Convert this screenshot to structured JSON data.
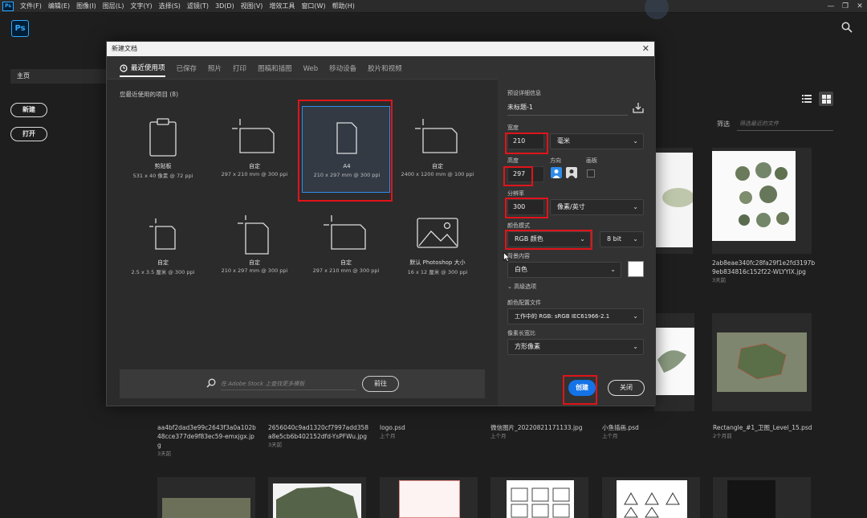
{
  "menubar": {
    "logo": "Ps",
    "items": [
      "文件(F)",
      "编辑(E)",
      "图像(I)",
      "图层(L)",
      "文字(Y)",
      "选择(S)",
      "滤镜(T)",
      "3D(D)",
      "视图(V)",
      "增效工具",
      "窗口(W)",
      "帮助(H)"
    ],
    "window_controls": [
      "—",
      "❐",
      "✕"
    ]
  },
  "home": {
    "logo": "Ps",
    "sidebar_tab": "主页",
    "new_button": "新建",
    "open_button": "打开",
    "filter_label": "筛选",
    "filter_placeholder": "筛选最近的文件"
  },
  "background_files": [
    {
      "name": "2ab8eae340fc28fa29f1e2fd3197b9eb834816c152f22-WLYYIX.jpg",
      "time": "3天前"
    },
    {
      "name": "aa4bf2dad3e99c2643f3a0a102b48cce377de9f83ec59-emxjgx.jpg",
      "time": "3天前"
    },
    {
      "name": "2656040c9ad1320cf7997add358a8e5cb6b402152dfd-YsPFWu.jpg",
      "time": "3天前"
    },
    {
      "name": "logo.psd",
      "time": "上个月"
    },
    {
      "name": "微信图片_20220821171133.jpg",
      "time": "上个月"
    },
    {
      "name": "小鱼插画.psd",
      "time": "上个月"
    },
    {
      "name": "Rectangle_#1_卫图_Level_15.psd",
      "time": "2个月前"
    }
  ],
  "dialog": {
    "title": "新建文档",
    "close_icon": "✕",
    "tabs": [
      "最近使用项",
      "已保存",
      "照片",
      "打印",
      "图稿和插图",
      "Web",
      "移动设备",
      "胶片和视频"
    ],
    "recent_label": "您最近使用的项目 (8)",
    "presets": [
      {
        "name": "剪贴板",
        "size": "531 x 40 像素 @ 72 ppi"
      },
      {
        "name": "自定",
        "size": "297 x 210 mm @ 300 ppi"
      },
      {
        "name": "A4",
        "size": "210 x 297 mm @ 300 ppi"
      },
      {
        "name": "自定",
        "size": "2400 x 1200 mm @ 100 ppi"
      },
      {
        "name": "自定",
        "size": "2.5 x 3.5 厘米 @ 300 ppi"
      },
      {
        "name": "自定",
        "size": "210 x 297 mm @ 300 ppi"
      },
      {
        "name": "自定",
        "size": "297 x 210 mm @ 300 ppi"
      },
      {
        "name": "默认 Photoshop 大小",
        "size": "16 x 12 厘米 @ 300 ppi"
      }
    ],
    "stock": {
      "placeholder": "在 Adobe Stock 上查找更多模板",
      "go_button": "前往"
    },
    "details": {
      "section_label": "预设详细信息",
      "doc_name": "未标题-1",
      "width_label": "宽度",
      "width_value": "210",
      "unit_value": "毫米",
      "height_label": "高度",
      "height_value": "297",
      "orientation_label": "方向",
      "artboard_label": "画板",
      "resolution_label": "分辨率",
      "resolution_value": "300",
      "resolution_unit": "像素/英寸",
      "color_mode_label": "颜色模式",
      "color_mode_value": "RGB 颜色",
      "bit_value": "8 bit",
      "background_label": "背景内容",
      "background_value": "白色",
      "advanced_label": "高级选项",
      "profile_label": "颜色配置文件",
      "profile_value": "工作中的 RGB: sRGB IEC61966-2.1",
      "pixel_ratio_label": "像素长宽比",
      "pixel_ratio_value": "方形像素"
    },
    "create_button": "创建",
    "close_button": "关闭"
  },
  "colors": {
    "accent": "#1473e6",
    "highlight": "#e0141a",
    "selection": "#2d8ceb"
  }
}
